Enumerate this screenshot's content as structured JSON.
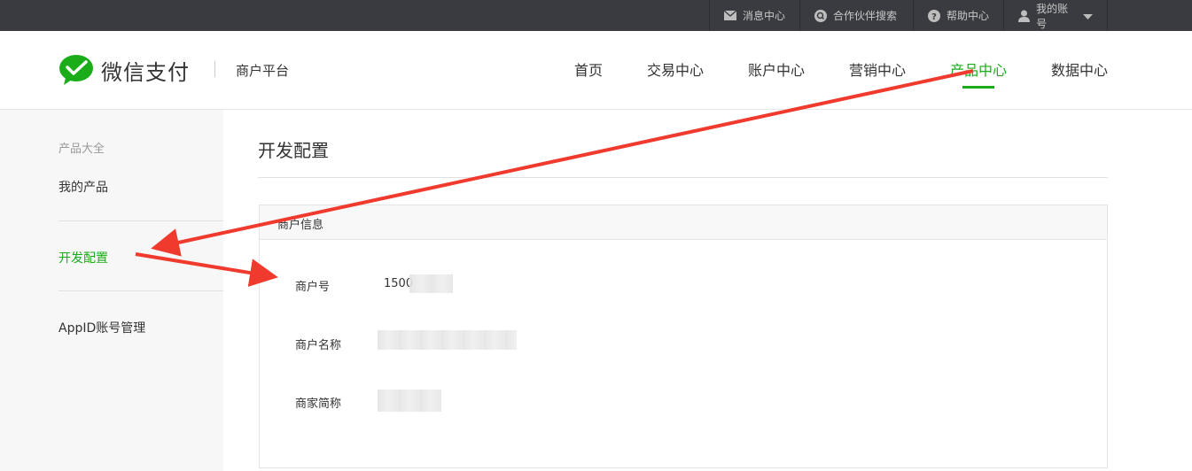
{
  "topbar": {
    "items": [
      {
        "label": "消息中心",
        "icon": "mail-icon"
      },
      {
        "label": "合作伙伴搜索",
        "icon": "search-icon"
      },
      {
        "label": "帮助中心",
        "icon": "help-icon"
      },
      {
        "label": "我的账号",
        "icon": "user-icon"
      }
    ]
  },
  "header": {
    "brand": "微信支付",
    "platform": "商户平台",
    "nav": [
      "首页",
      "交易中心",
      "账户中心",
      "营销中心",
      "产品中心",
      "数据中心"
    ],
    "active_nav": "产品中心"
  },
  "sidebar": {
    "group_label": "产品大全",
    "items": [
      "我的产品",
      "开发配置",
      "AppID账号管理"
    ],
    "active_item": "开发配置"
  },
  "main": {
    "title": "开发配置",
    "panel": {
      "heading": "商户信息",
      "fields": [
        {
          "label": "商户号",
          "value": "1500"
        },
        {
          "label": "商户名称",
          "value": ""
        },
        {
          "label": "商家简称",
          "value": ""
        }
      ]
    }
  },
  "colors": {
    "accent": "#1aad19",
    "topbar": "#3a3b40",
    "arrow": "#f03a2e"
  }
}
